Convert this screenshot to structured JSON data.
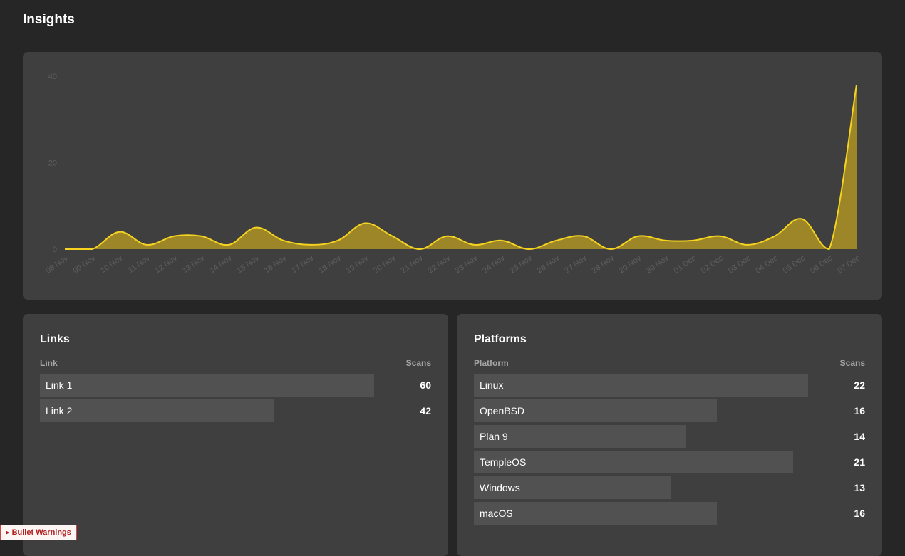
{
  "page": {
    "title": "Insights"
  },
  "chart_data": {
    "type": "area",
    "x": [
      "08 Nov",
      "09 Nov",
      "10 Nov",
      "11 Nov",
      "12 Nov",
      "13 Nov",
      "14 Nov",
      "15 Nov",
      "16 Nov",
      "17 Nov",
      "18 Nov",
      "19 Nov",
      "20 Nov",
      "21 Nov",
      "22 Nov",
      "23 Nov",
      "24 Nov",
      "25 Nov",
      "26 Nov",
      "27 Nov",
      "28 Nov",
      "29 Nov",
      "30 Nov",
      "01 Dec",
      "02 Dec",
      "03 Dec",
      "04 Dec",
      "05 Dec",
      "06 Dec",
      "07 Dec"
    ],
    "values": [
      0,
      0,
      4,
      1,
      3,
      3,
      1,
      5,
      2,
      1,
      2,
      6,
      3,
      0,
      3,
      1,
      2,
      0,
      2,
      3,
      0,
      3,
      2,
      2,
      3,
      1,
      3,
      7,
      0,
      38
    ],
    "yticks": [
      0,
      20,
      40
    ],
    "ylim": [
      0,
      40
    ],
    "color": "#f5d31f",
    "fill": "#9c8628"
  },
  "links": {
    "title": "Links",
    "col_name": "Link",
    "col_value": "Scans",
    "max": 60,
    "rows": [
      {
        "label": "Link 1",
        "value": 60
      },
      {
        "label": "Link 2",
        "value": 42
      }
    ]
  },
  "platforms": {
    "title": "Platforms",
    "col_name": "Platform",
    "col_value": "Scans",
    "max": 22,
    "rows": [
      {
        "label": "Linux",
        "value": 22
      },
      {
        "label": "OpenBSD",
        "value": 16
      },
      {
        "label": "Plan 9",
        "value": 14
      },
      {
        "label": "TempleOS",
        "value": 21
      },
      {
        "label": "Windows",
        "value": 13
      },
      {
        "label": "macOS",
        "value": 16
      }
    ]
  },
  "warnings": {
    "label": "▸ Bullet Warnings"
  }
}
